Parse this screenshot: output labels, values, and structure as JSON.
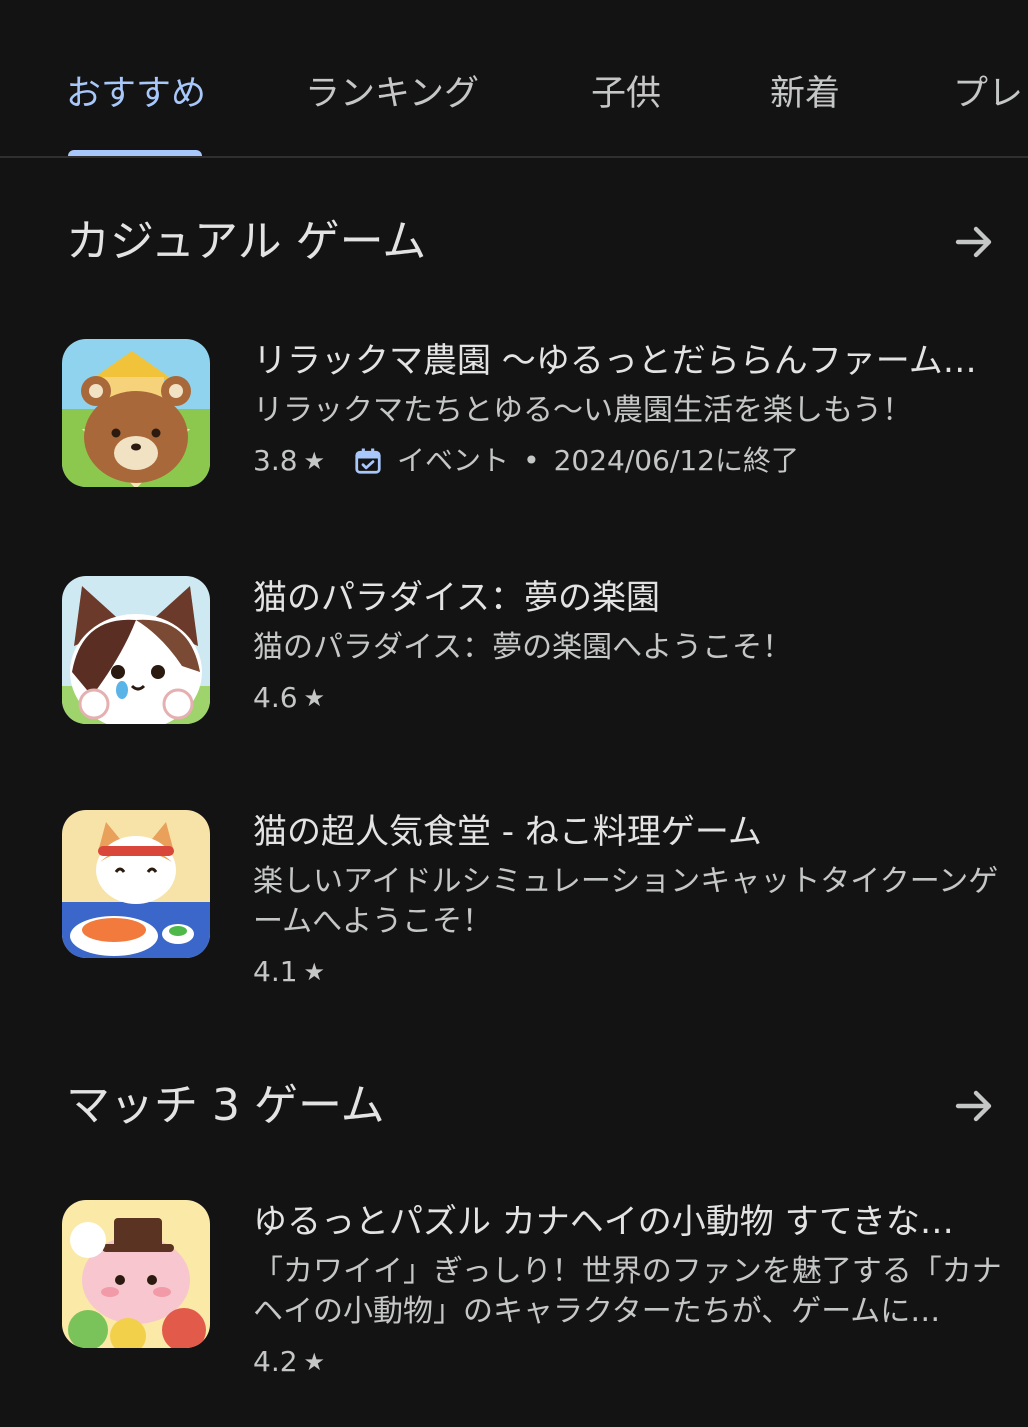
{
  "tabs": [
    {
      "label": "おすすめ",
      "active": true
    },
    {
      "label": "ランキング",
      "active": false
    },
    {
      "label": "子供",
      "active": false
    },
    {
      "label": "新着",
      "active": false
    },
    {
      "label": "プレ",
      "active": false
    }
  ],
  "sections": [
    {
      "title": "カジュアル ゲーム",
      "apps": [
        {
          "title": "リラックマ農園 〜ゆるっとだららんファーム…",
          "description": "リラックマたちとゆる〜い農園生活を楽しもう！",
          "rating": "3.8",
          "event_label": "イベント",
          "event_date": "2024/06/12に終了"
        },
        {
          "title": "猫のパラダイス：夢の楽園",
          "description": "猫のパラダイス：夢の楽園へようこそ！",
          "rating": "4.6"
        },
        {
          "title": "猫の超人気食堂 - ねこ料理ゲーム",
          "description": "楽しいアイドルシミュレーションキャットタイクーンゲームへようこそ！",
          "rating": "4.1"
        }
      ]
    },
    {
      "title": "マッチ 3 ゲーム",
      "apps": [
        {
          "title": "ゆるっとパズル カナヘイの小動物 すてきな…",
          "description": "「カワイイ」ぎっしり！世界のファンを魅了する「カナヘイの小動物」のキャラクターたちが、ゲームに…",
          "rating": "4.2"
        }
      ]
    }
  ],
  "icons": {
    "arrow": "arrow-right-icon",
    "star": "star-icon",
    "event": "calendar-check-icon"
  },
  "colors": {
    "background": "#131313",
    "accent": "#a8c7fa",
    "text_primary": "#e3e3e3",
    "text_secondary": "#c4c7c5"
  }
}
